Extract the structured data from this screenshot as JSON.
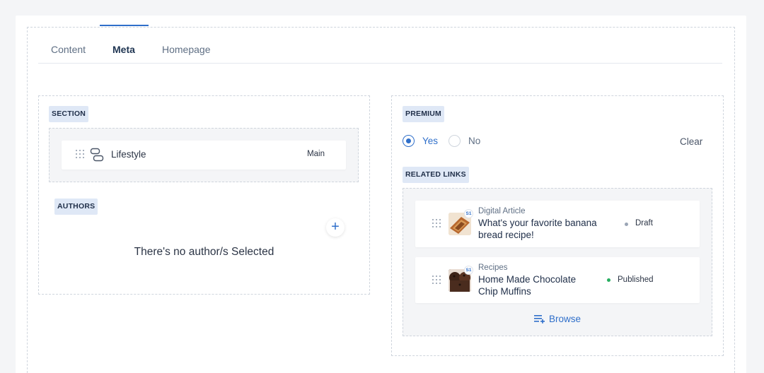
{
  "tabs": [
    "Content",
    "Meta",
    "Homepage"
  ],
  "active_tab": "Meta",
  "section": {
    "badge": "SECTION",
    "item": {
      "label": "Lifestyle",
      "tag": "Main"
    }
  },
  "authors": {
    "badge": "AUTHORS",
    "empty_text": "There's no author/s Selected"
  },
  "premium": {
    "badge": "PREMIUM",
    "options": [
      "Yes",
      "No"
    ],
    "selected": "Yes",
    "clear_label": "Clear"
  },
  "related_links": {
    "badge": "RELATED LINKS",
    "items": [
      {
        "category": "Digital Article",
        "title_line1": "What's your favorite banana",
        "title_line2": "bread recipe!",
        "badge": "S1",
        "status": "Draft",
        "status_color": "#9aa5b5"
      },
      {
        "category": "Recipes",
        "title_line1": "Home Made Chocolate",
        "title_line2": "Chip Muffins",
        "badge": "S1",
        "status": "Published",
        "status_color": "#27ae60"
      }
    ],
    "browse_label": "Browse"
  },
  "colors": {
    "accent": "#2f6fca",
    "badge_bg": "#dfe8f6",
    "text": "#2b3445"
  }
}
